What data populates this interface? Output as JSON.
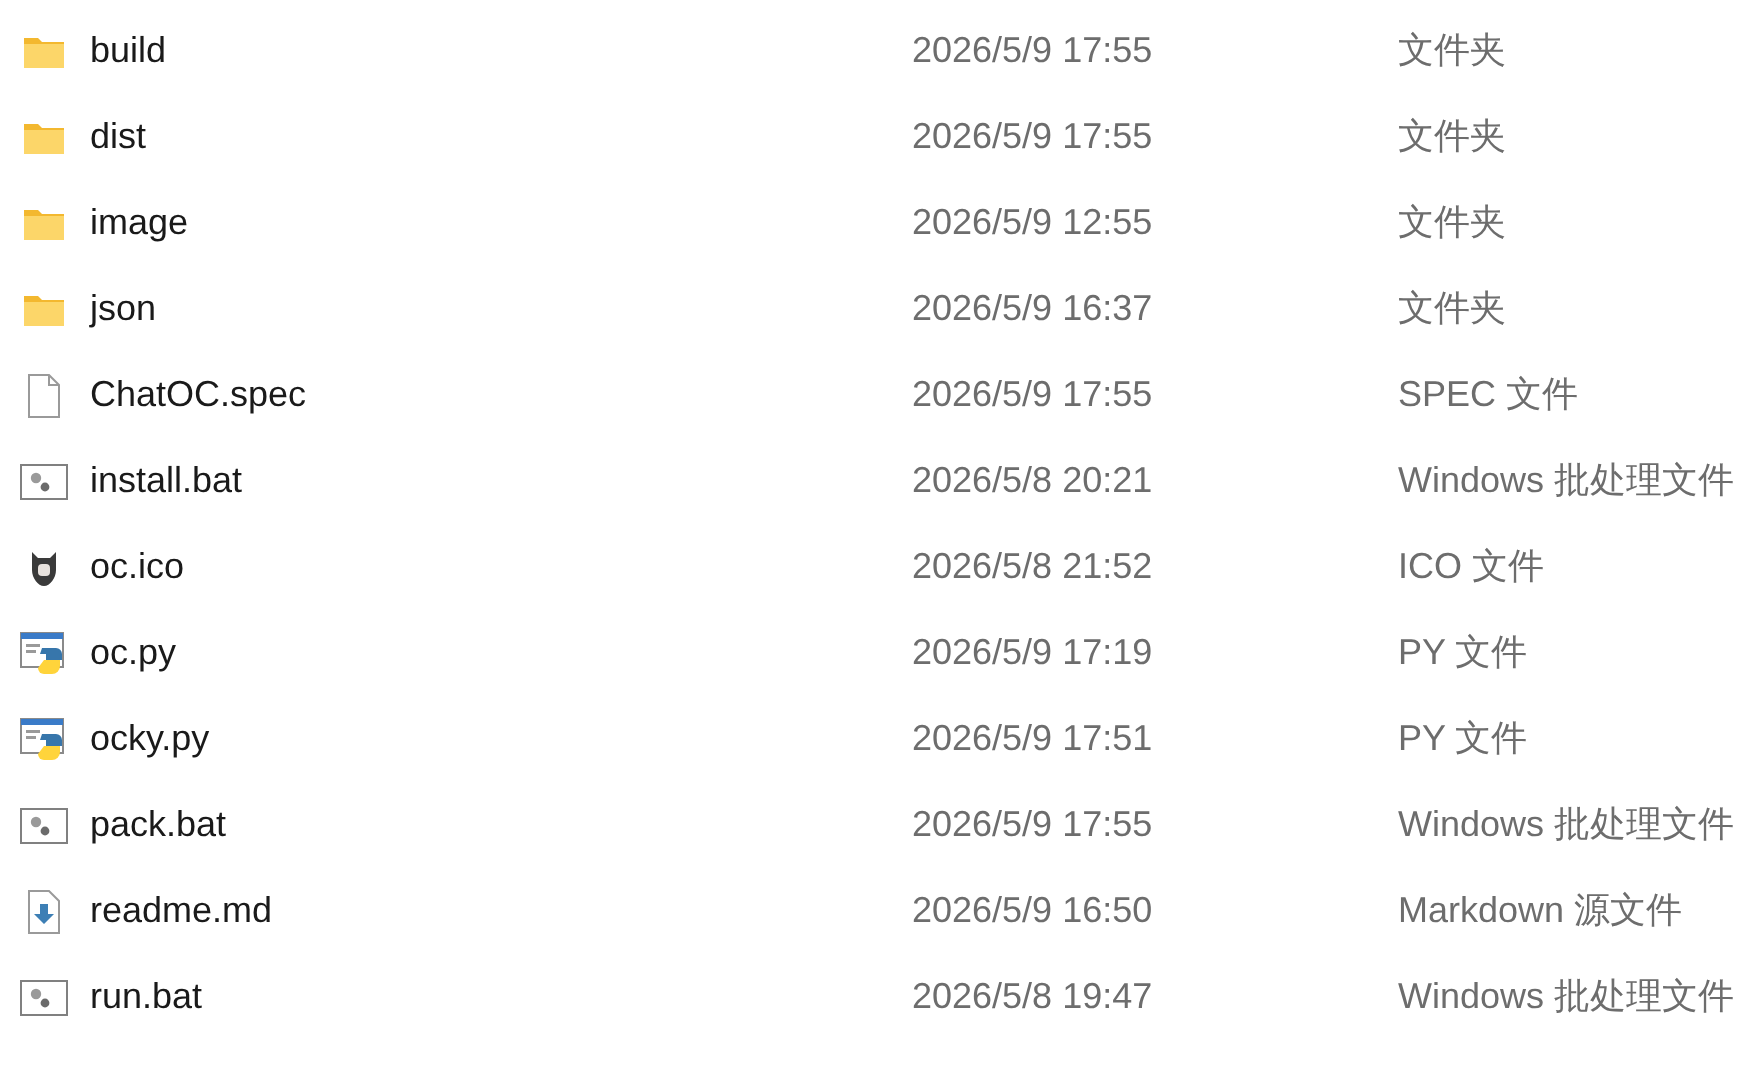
{
  "files": [
    {
      "name": "build",
      "modified": "2026/5/9 17:55",
      "type": "文件夹",
      "kind": "folder"
    },
    {
      "name": "dist",
      "modified": "2026/5/9 17:55",
      "type": "文件夹",
      "kind": "folder"
    },
    {
      "name": "image",
      "modified": "2026/5/9 12:55",
      "type": "文件夹",
      "kind": "folder"
    },
    {
      "name": "json",
      "modified": "2026/5/9 16:37",
      "type": "文件夹",
      "kind": "folder"
    },
    {
      "name": "ChatOC.spec",
      "modified": "2026/5/9 17:55",
      "type": "SPEC 文件",
      "kind": "blank"
    },
    {
      "name": "install.bat",
      "modified": "2026/5/8 20:21",
      "type": "Windows 批处理文件",
      "kind": "batch"
    },
    {
      "name": "oc.ico",
      "modified": "2026/5/8 21:52",
      "type": "ICO 文件",
      "kind": "image"
    },
    {
      "name": "oc.py",
      "modified": "2026/5/9 17:19",
      "type": "PY 文件",
      "kind": "python"
    },
    {
      "name": "ocky.py",
      "modified": "2026/5/9 17:51",
      "type": "PY 文件",
      "kind": "python"
    },
    {
      "name": "pack.bat",
      "modified": "2026/5/9 17:55",
      "type": "Windows 批处理文件",
      "kind": "batch"
    },
    {
      "name": "readme.md",
      "modified": "2026/5/9 16:50",
      "type": "Markdown 源文件",
      "kind": "markdown"
    },
    {
      "name": "run.bat",
      "modified": "2026/5/8 19:47",
      "type": "Windows 批处理文件",
      "kind": "batch"
    }
  ]
}
